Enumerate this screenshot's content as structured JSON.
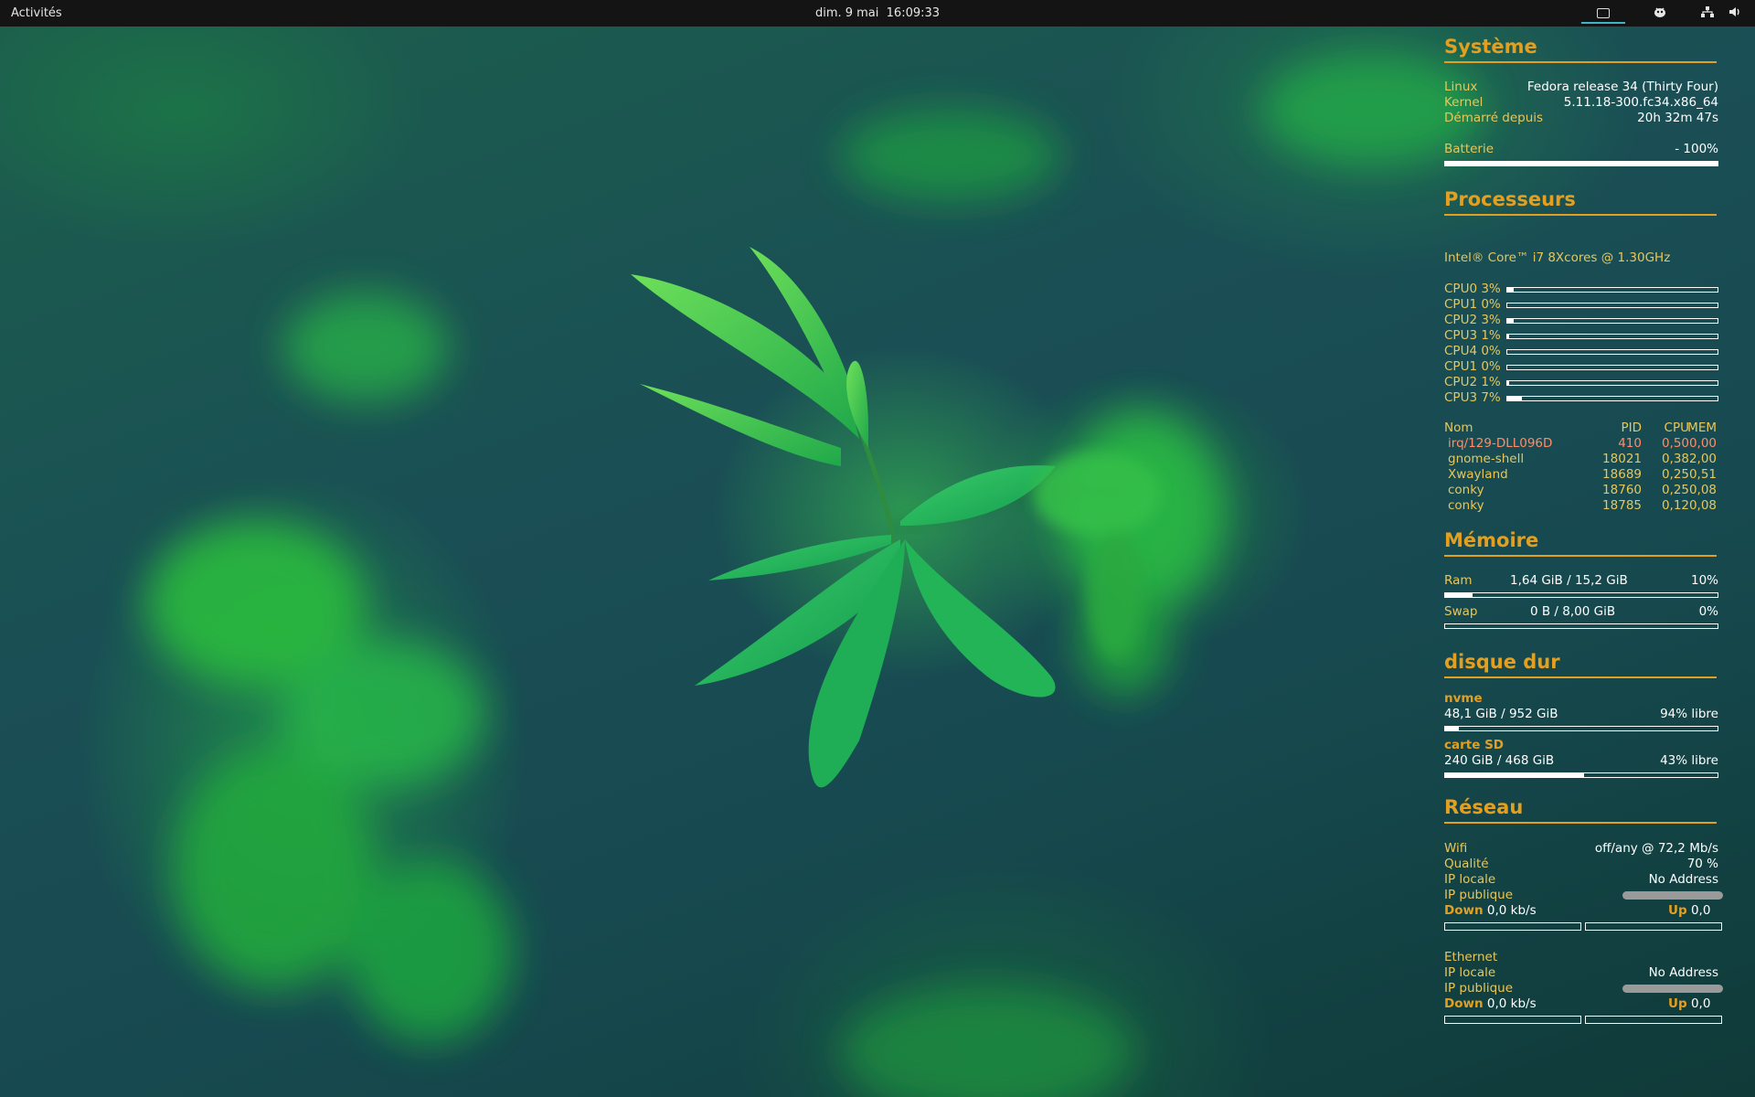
{
  "topbar": {
    "activities": "Activités",
    "clock_date": "dim. 9 mai",
    "clock_time": "16:09:33",
    "tray_icons": [
      "screencast-icon",
      "goose-icon",
      "network-icon",
      "volume-icon"
    ]
  },
  "systeme": {
    "title": "Système",
    "rows": [
      {
        "label": "Linux",
        "value": "Fedora release 34 (Thirty Four)"
      },
      {
        "label": "Kernel",
        "value": "5.11.18-300.fc34.x86_64"
      },
      {
        "label": "Démarré depuis",
        "value": "20h 32m 47s"
      }
    ],
    "battery_label": "Batterie",
    "battery_value": "- 100%",
    "battery_fraction": 1.0
  },
  "processeurs": {
    "title": "Processeurs",
    "model": "Intel® Core™ i7 8Xcores @ 1.30GHz",
    "cpus": [
      {
        "label": "CPU0 3%",
        "fraction": 0.03
      },
      {
        "label": "CPU1 0%",
        "fraction": 0.0
      },
      {
        "label": "CPU2 3%",
        "fraction": 0.03
      },
      {
        "label": "CPU3 1%",
        "fraction": 0.01
      },
      {
        "label": "CPU4 0%",
        "fraction": 0.0
      },
      {
        "label": "CPU1 0%",
        "fraction": 0.0
      },
      {
        "label": "CPU2 1%",
        "fraction": 0.01
      },
      {
        "label": "CPU3 7%",
        "fraction": 0.07
      }
    ],
    "table_headers": {
      "name": "Nom",
      "pid": "PID",
      "cpu": "CPU",
      "mem": "MEM"
    },
    "table_rows": [
      {
        "name": "irq/129-DLL096D",
        "pid": "410",
        "cpu": "0,50",
        "mem": "0,00"
      },
      {
        "name": "gnome-shell",
        "pid": "18021",
        "cpu": "0,38",
        "mem": "2,00"
      },
      {
        "name": "Xwayland",
        "pid": "18689",
        "cpu": "0,25",
        "mem": "0,51"
      },
      {
        "name": "conky",
        "pid": "18760",
        "cpu": "0,25",
        "mem": "0,08"
      },
      {
        "name": "conky",
        "pid": "18785",
        "cpu": "0,12",
        "mem": "0,08"
      }
    ]
  },
  "memoire": {
    "title": "Mémoire",
    "ram_label": "Ram",
    "ram_value": "1,64 GiB / 15,2 GiB",
    "ram_percent": "10%",
    "ram_fraction": 0.1,
    "swap_label": "Swap",
    "swap_value": "0 B / 8,00 GiB",
    "swap_percent": "0%",
    "swap_fraction": 0.0
  },
  "disque": {
    "title": "disque dur",
    "disks": [
      {
        "name": "nvme",
        "usage": "48,1 GiB / 952 GiB",
        "free": "94% libre",
        "used_fraction": 0.05
      },
      {
        "name": "carte SD",
        "usage": "240 GiB / 468 GiB",
        "free": "43% libre",
        "used_fraction": 0.51
      }
    ]
  },
  "reseau": {
    "title": "Réseau",
    "wifi": {
      "label": "Wifi",
      "value": "off/any @ 72,2 Mb/s",
      "quality_label": "Qualité",
      "quality_value": "70 %",
      "ip_local_label": "IP locale",
      "ip_local_value": "No Address",
      "ip_public_label": "IP publique",
      "down_label": "Down",
      "down_value": "0,0 kb/s",
      "up_label": "Up",
      "up_value": "0,0"
    },
    "ethernet": {
      "label": "Ethernet",
      "ip_local_label": "IP locale",
      "ip_local_value": "No Address",
      "ip_public_label": "IP publique",
      "down_label": "Down",
      "down_value": "0,0 kb/s",
      "up_label": "Up",
      "up_value": "0,0"
    }
  },
  "colors": {
    "accent": "#e3a020",
    "label": "#e8c65a",
    "value": "#ffffff",
    "topbar": "#141414",
    "highlight_process": "#ff8c6a"
  }
}
